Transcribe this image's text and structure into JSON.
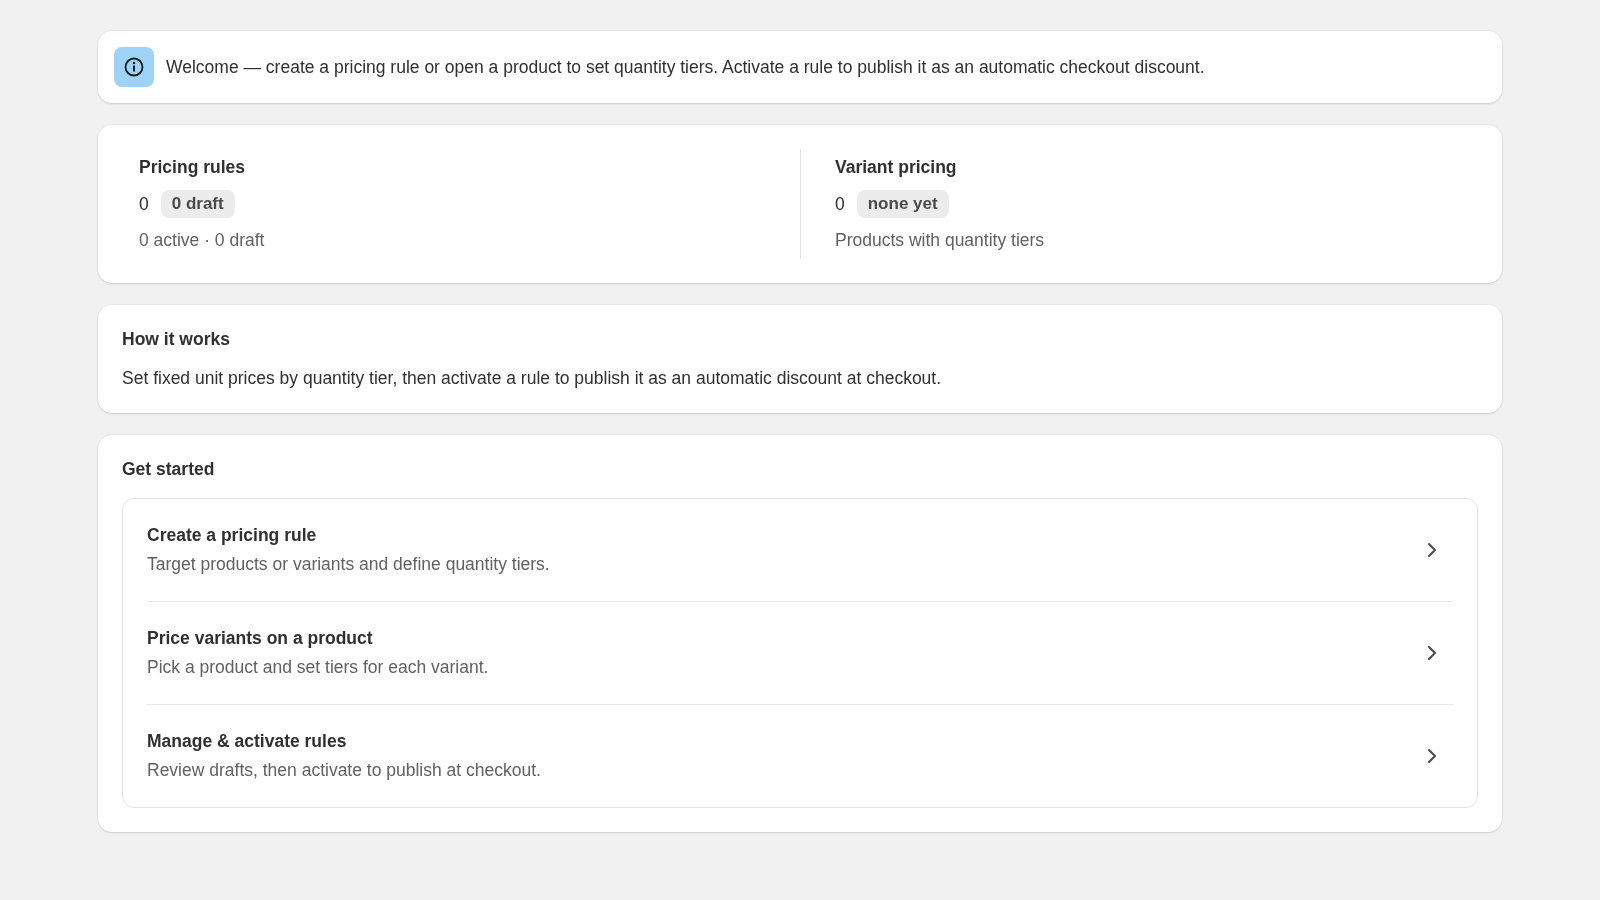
{
  "banner": {
    "text": "Welcome — create a pricing rule or open a product to set quantity tiers. Activate a rule to publish it as an automatic checkout discount."
  },
  "stats": [
    {
      "title": "Pricing rules",
      "value": "0",
      "badge": "0 draft",
      "caption": "0 active · 0 draft"
    },
    {
      "title": "Variant pricing",
      "value": "0",
      "badge": "none yet",
      "caption": "Products with quantity tiers"
    }
  ],
  "how_it_works": {
    "title": "How it works",
    "text": "Set fixed unit prices by quantity tier, then activate a rule to publish it as an automatic discount at checkout."
  },
  "get_started": {
    "title": "Get started",
    "items": [
      {
        "title": "Create a pricing rule",
        "description": "Target products or variants and define quantity tiers."
      },
      {
        "title": "Price variants on a product",
        "description": "Pick a product and set tiers for each variant."
      },
      {
        "title": "Manage & activate rules",
        "description": "Review drafts, then activate to publish at checkout."
      }
    ]
  }
}
